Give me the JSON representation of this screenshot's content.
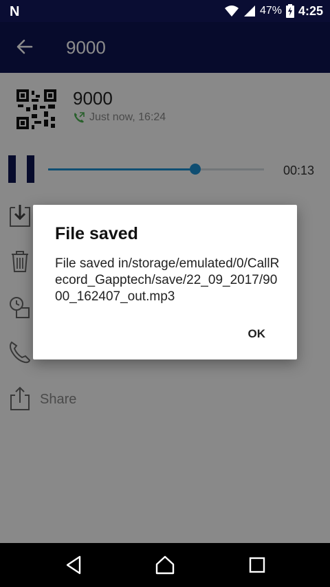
{
  "status_bar": {
    "notification_icon": "N",
    "battery_percent": "47%",
    "time": "4:25",
    "icons": [
      "wifi-icon",
      "signal-icon",
      "battery-charging-icon"
    ]
  },
  "app_bar": {
    "title": "9000",
    "back_icon": "arrow-left-icon"
  },
  "recording": {
    "contact_name": "9000",
    "call_time": "Just now, 16:24",
    "elapsed": "00:13",
    "progress": 0.68
  },
  "actions": {
    "share_label": "Share",
    "icons": [
      "save-icon",
      "delete-icon",
      "schedule-icon",
      "call-icon",
      "share-icon"
    ]
  },
  "dialog": {
    "title": "File saved",
    "message": "File saved in/storage/emulated/0/CallRecord_Gapptech/save/22_09_2017/9000_162407_out.mp3",
    "ok_label": "OK"
  },
  "colors": {
    "status_bar": "#0a0d33",
    "app_bar": "#0d1550",
    "accent": "#1d8fcf"
  }
}
